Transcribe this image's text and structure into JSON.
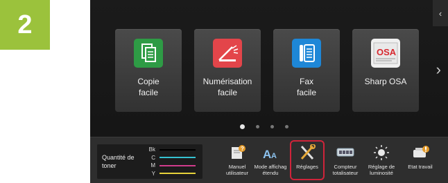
{
  "step_number": "2",
  "tiles": [
    {
      "line1": "Copie",
      "line2": "facile",
      "icon": "copy-icon",
      "color": "#2e9b45"
    },
    {
      "line1": "Numérisation",
      "line2": "facile",
      "icon": "scan-icon",
      "color": "#e3454a"
    },
    {
      "line1": "Fax",
      "line2": "facile",
      "icon": "fax-icon",
      "color": "#1e87d7"
    },
    {
      "line1": "Sharp OSA",
      "line2": "",
      "icon": "sharp-osa-icon",
      "color": "#f0f0f0"
    }
  ],
  "side_tab_icon": "chevron-left-icon",
  "next_icon": "chevron-right-icon",
  "page_indicator": {
    "count": 4,
    "active": 1
  },
  "toner": {
    "title_line1": "Quantité de",
    "title_line2": "toner",
    "rows": [
      {
        "label": "Bk",
        "color": "#000000"
      },
      {
        "label": "C",
        "color": "#36c3d3"
      },
      {
        "label": "M",
        "color": "#d23c8c"
      },
      {
        "label": "Y",
        "color": "#e6d23a"
      }
    ]
  },
  "bottom_buttons": [
    {
      "line1": "Manuel",
      "line2": "utilisateur",
      "icon": "manual-icon"
    },
    {
      "line1": "Mode affichag",
      "line2": "étendu",
      "icon": "text-size-icon"
    },
    {
      "line1": "Réglages",
      "line2": "",
      "icon": "settings-tools-icon",
      "highlight_color": "#d0243a"
    },
    {
      "line1": "Compteur",
      "line2": "totalisateur",
      "icon": "counter-icon"
    },
    {
      "line1": "Réglage de",
      "line2": "luminosité",
      "icon": "brightness-icon"
    },
    {
      "line1": "Etat travail",
      "line2": "",
      "icon": "job-status-icon"
    }
  ]
}
